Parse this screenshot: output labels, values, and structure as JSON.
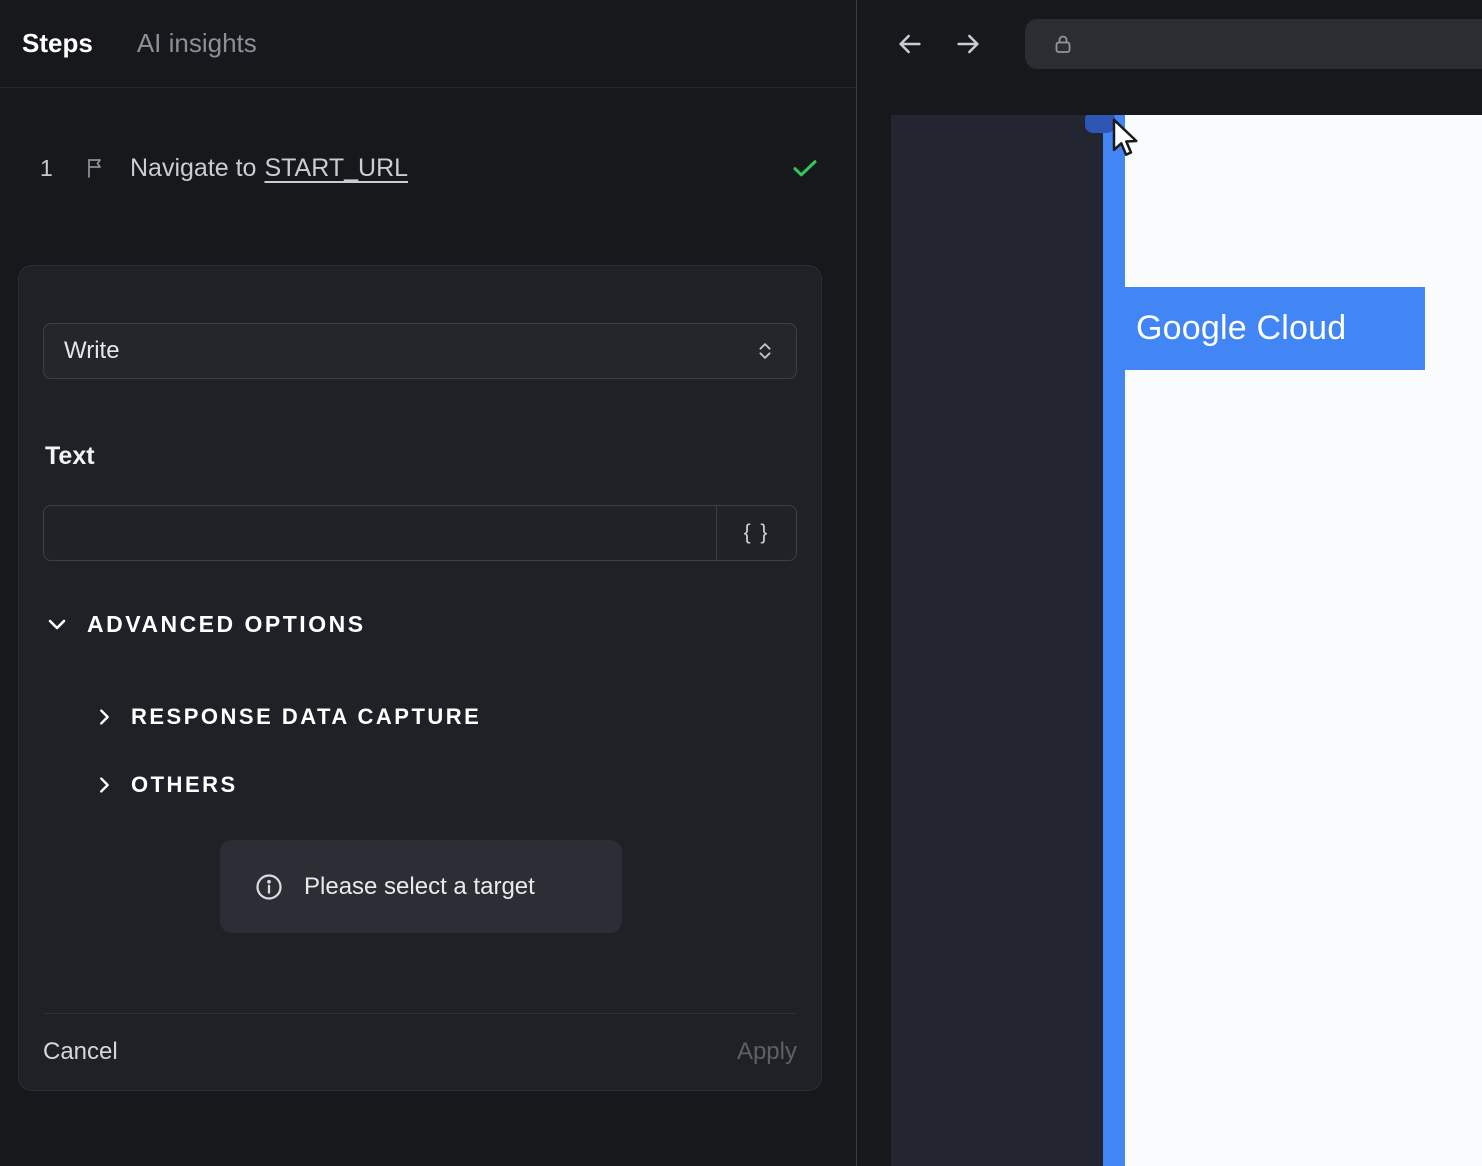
{
  "header": {
    "tab_steps": "Steps",
    "tab_ai_insights": "AI insights"
  },
  "step": {
    "number": "1",
    "action_text": "Navigate to",
    "target_text": "START_URL",
    "status": "success"
  },
  "editor": {
    "action_value": "Write",
    "text_label": "Text",
    "text_value": "",
    "variable_button": "{ }",
    "advanced_options_label": "ADVANCED OPTIONS",
    "sections": {
      "response_data_capture": "RESPONSE DATA CAPTURE",
      "others": "OTHERS"
    },
    "toast_message": "Please select a target",
    "cancel_label": "Cancel",
    "apply_label": "Apply"
  },
  "preview": {
    "highlight_label": "Google Cloud"
  },
  "colors": {
    "accent_blue": "#4285f4",
    "success_green": "#34c85a",
    "panel_dark": "#17181c",
    "card_dark": "#1e2126"
  }
}
